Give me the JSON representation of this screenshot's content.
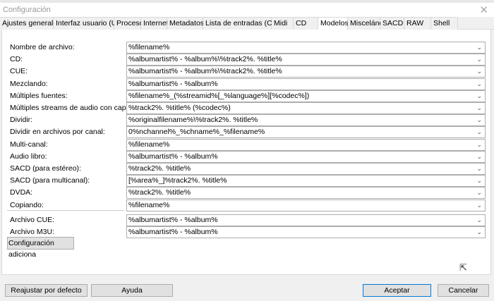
{
  "window": {
    "title": "Configuración",
    "close": "✕"
  },
  "tabs": [
    {
      "label": "Ajustes generales",
      "active": false
    },
    {
      "label": "Interfaz usuario (UI)",
      "active": false
    },
    {
      "label": "Proceso",
      "active": false
    },
    {
      "label": "Internet",
      "active": false
    },
    {
      "label": "Metadatos",
      "active": false
    },
    {
      "label": "Lista de entradas (CUE)",
      "active": false
    },
    {
      "label": "Midi",
      "active": false
    },
    {
      "label": "CD",
      "active": false
    },
    {
      "label": "Modelos",
      "active": true
    },
    {
      "label": "Miscelánea",
      "active": false
    },
    {
      "label": "SACD",
      "active": false
    },
    {
      "label": "RAW",
      "active": false
    },
    {
      "label": "Shell",
      "active": false
    }
  ],
  "fields": [
    {
      "label": "Nombre de archivo:",
      "value": "%filename%"
    },
    {
      "label": "CD:",
      "value": "%albumartist% - %album%\\%track2%. %title%"
    },
    {
      "label": "CUE:",
      "value": "%albumartist% - %album%\\%track2%. %title%"
    },
    {
      "label": "Mezclando:",
      "value": "%albumartist% - %album%"
    },
    {
      "label": "Múltiples fuentes:",
      "value": "%filename%_(%streamid%[_%language%][%codec%])"
    },
    {
      "label": "Múltiples streams de audio con capítulos:",
      "value": "%track2%. %title% (%codec%)"
    },
    {
      "label": "Dividir:",
      "value": "%originalfilename%\\%track2%. %title%"
    },
    {
      "label": "Dividir en archivos por canal:",
      "value": "0%nchannel%_%chname%_%filename%"
    },
    {
      "label": "Multi-canal:",
      "value": "%filename%"
    },
    {
      "label": "Audio libro:",
      "value": "%albumartist% - %album%"
    },
    {
      "label": "SACD (para estéreo):",
      "value": "%track2%. %title%"
    },
    {
      "label": "SACD (para multicanal):",
      "value": "[%area%_]%track2%. %title%"
    },
    {
      "label": "DVDA:",
      "value": "%track2%. %title%"
    },
    {
      "label": "Copiando:",
      "value": "%filename%"
    },
    {
      "label": "Archivo CUE:",
      "value": "%albumartist% - %album%"
    },
    {
      "label": "Archivo M3U:",
      "value": "%albumartist% - %album%"
    }
  ],
  "buttons": {
    "extra": "Configuración adiciona",
    "reset": "Reajustar por defecto",
    "help": "Ayuda",
    "ok": "Aceptar",
    "cancel": "Cancelar"
  },
  "icons": {
    "chevron": "⌄"
  }
}
